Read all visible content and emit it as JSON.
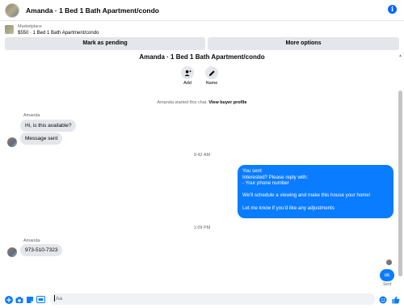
{
  "header": {
    "title": "Amanda · 1 Bed 1 Bath Apartment/condo",
    "info_icon": "info-icon"
  },
  "marketplace": {
    "label": "Marketplace",
    "listing": "$550 · 1 Bed 1 Bath Apartment/condo"
  },
  "actions": {
    "pending": "Mark as pending",
    "more": "More options"
  },
  "chat": {
    "title": "Amanda · 1 Bed 1 Bath Apartment/condo",
    "add_label": "Add",
    "name_label": "Name",
    "system_prefix": "Amanda started this chat.",
    "system_link": "View buyer profile",
    "sender_1": "Amanda",
    "msg_1": "Hi, is this available?",
    "msg_2": "Message sent",
    "time_1": "9:42 AM",
    "outgoing": {
      "line1": "You sent",
      "line2": "Interested? Please reply with:",
      "line3": "- Your phone number",
      "line4": "We'll schedule a viewing and make this house your home!",
      "line5": "Let me know if you'd like any adjustments"
    },
    "time_2": "1:09 PM",
    "sender_2": "Amanda",
    "msg_3": "973-510-7323",
    "ok_msg": "ok",
    "status": "Sent"
  },
  "composer": {
    "placeholder": "Aa"
  },
  "colors": {
    "accent": "#0a7cff",
    "incoming_bubble": "#e4e6eb",
    "muted_text": "#65676b"
  }
}
